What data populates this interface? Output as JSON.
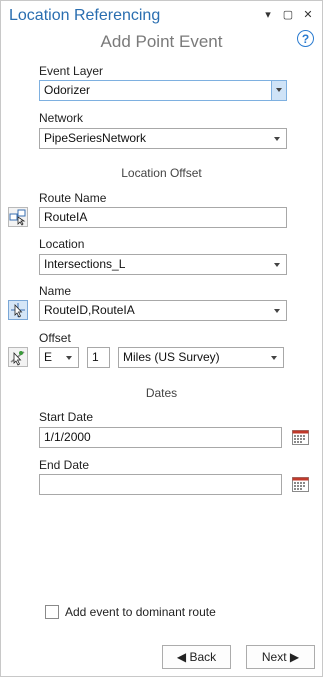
{
  "pane": {
    "title": "Location Referencing",
    "subtitle": "Add Point Event",
    "controls": {
      "dropdown": "▾",
      "maximize": "▢",
      "close": "✕"
    },
    "help": "?"
  },
  "event_layer": {
    "label": "Event Layer",
    "value": "Odorizer"
  },
  "network": {
    "label": "Network",
    "value": "PipeSeriesNetwork"
  },
  "location_offset": {
    "heading": "Location Offset"
  },
  "route_name": {
    "label": "Route Name",
    "value": "RouteIA"
  },
  "location": {
    "label": "Location",
    "value": "Intersections_L"
  },
  "name": {
    "label": "Name",
    "value": "RouteID,RouteIA"
  },
  "offset": {
    "label": "Offset",
    "direction": "E",
    "distance": "1",
    "units": "Miles (US Survey)"
  },
  "dates": {
    "heading": "Dates",
    "start_label": "Start Date",
    "start_value": "1/1/2000",
    "end_label": "End Date",
    "end_value": ""
  },
  "dominant_route": {
    "label": "Add event to dominant route",
    "checked": false
  },
  "buttons": {
    "back": "◀ Back",
    "next": "Next ▶"
  },
  "colors": {
    "title_blue": "#2a6eb0",
    "help_blue": "#2a7bd0",
    "calendar_red": "#c0392b"
  }
}
